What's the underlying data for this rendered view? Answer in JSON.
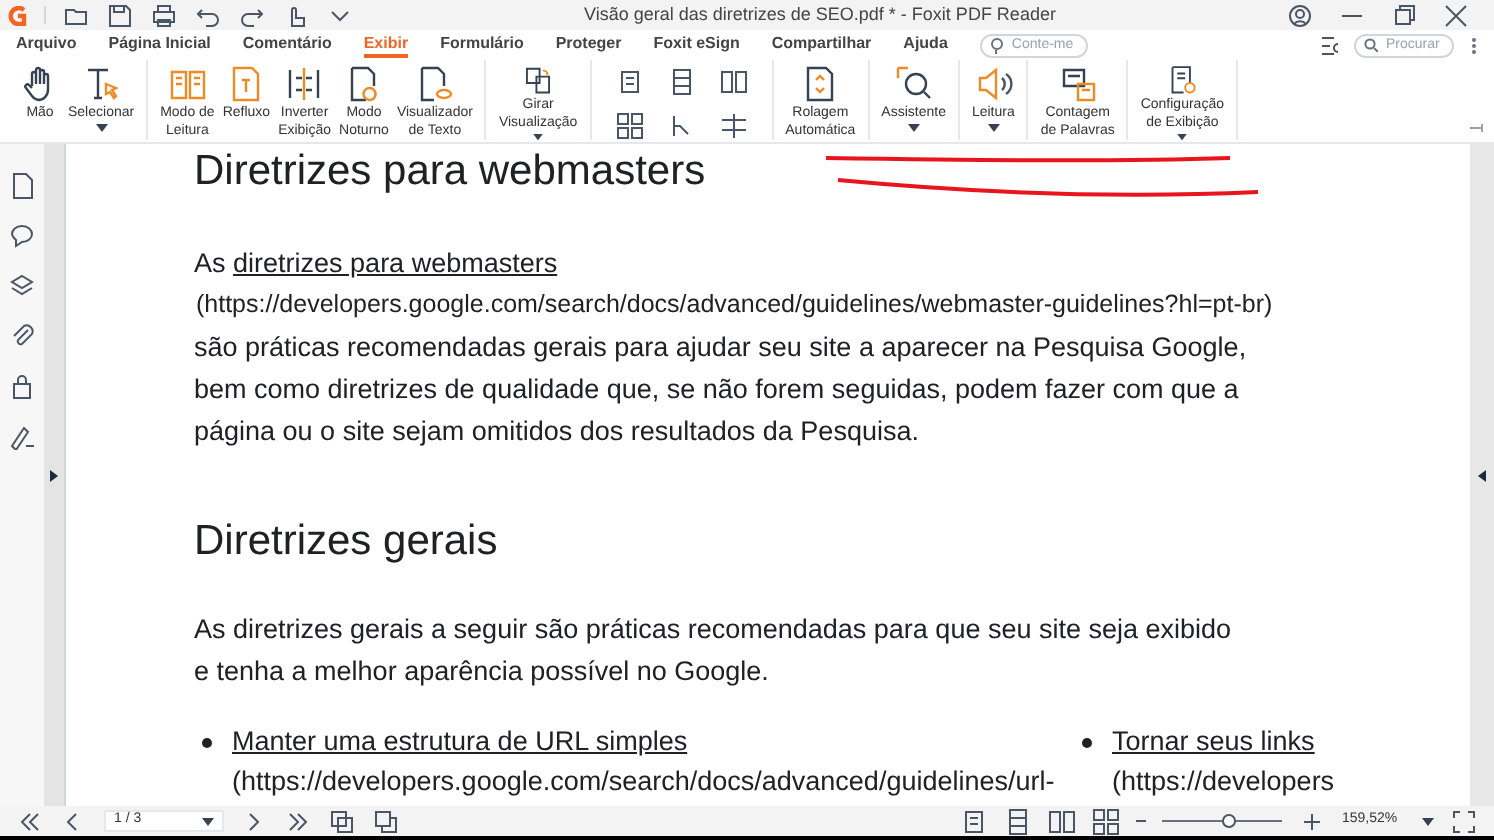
{
  "window": {
    "title": "Visão geral das diretrizes de SEO.pdf * - Foxit PDF Reader"
  },
  "menu_tabs": [
    {
      "label": "Arquivo",
      "selected": false
    },
    {
      "label": "Página Inicial",
      "selected": false
    },
    {
      "label": "Comentário",
      "selected": false
    },
    {
      "label": "Exibir",
      "selected": true
    },
    {
      "label": "Formulário",
      "selected": false
    },
    {
      "label": "Proteger",
      "selected": false
    },
    {
      "label": "Foxit eSign",
      "selected": false
    },
    {
      "label": "Compartilhar",
      "selected": false
    },
    {
      "label": "Ajuda",
      "selected": false
    }
  ],
  "tell_me": {
    "placeholder": "Conte-me"
  },
  "search": {
    "placeholder": "Procurar"
  },
  "ribbon": [
    {
      "kind": "group",
      "items": [
        {
          "label": "Mão",
          "dropdown": false
        },
        {
          "label": "Selecionar",
          "dropdown": true
        }
      ]
    },
    {
      "kind": "group",
      "items": [
        {
          "label": "Modo de\nLeitura",
          "dropdown": false
        },
        {
          "label": "Refluxo",
          "dropdown": false
        },
        {
          "label": "Inverter\nExibição",
          "dropdown": false
        },
        {
          "label": "Modo\nNoturno",
          "dropdown": false
        },
        {
          "label": "Visualizador\nde Texto",
          "dropdown": false
        }
      ]
    },
    {
      "kind": "group",
      "items": [
        {
          "label": "Girar\nVisualização",
          "dropdown": true
        }
      ]
    },
    {
      "kind": "layout"
    },
    {
      "kind": "group",
      "items": [
        {
          "label": "Rolagem\nAutomática",
          "dropdown": false
        }
      ]
    },
    {
      "kind": "group",
      "items": [
        {
          "label": "Assistente",
          "dropdown": true
        }
      ]
    },
    {
      "kind": "group",
      "items": [
        {
          "label": "Leitura",
          "dropdown": true
        }
      ]
    },
    {
      "kind": "group",
      "items": [
        {
          "label": "Contagem\nde Palavras",
          "dropdown": false
        }
      ]
    },
    {
      "kind": "group",
      "items": [
        {
          "label": "Configuração\nde Exibição",
          "dropdown": true
        }
      ]
    }
  ],
  "document": [
    {
      "kind": "heading",
      "text": "Diretrizes para webmasters"
    },
    {
      "kind": "paragraph",
      "link": "diretrizes para webmasters",
      "prefix": "As",
      "url": "(https://developers.google.com/search/docs/advanced/guidelines/webmaster-guidelines?hl=pt-br)",
      "text": "são práticas recomendadas gerais para ajudar seu site a aparecer na Pesquisa Google, bem como diretrizes de qualidade que, se não forem seguidas, podem fazer com que a página ou o site sejam omitidos dos resultados da Pesquisa."
    },
    {
      "kind": "heading",
      "text": "Diretrizes gerais"
    },
    {
      "kind": "plain",
      "text": "As diretrizes gerais a seguir são práticas recomendadas para que seu site seja exibido e tenha a melhor aparência possível no Google."
    },
    {
      "kind": "bullets",
      "items": [
        {
          "link": "Manter uma estrutura de URL simples",
          "url": "(https://developers.google.com/search/docs/advanced/guidelines/url-"
        },
        {
          "link": "Tornar seus links",
          "url": "(https://developers"
        }
      ]
    }
  ],
  "status_bar": {
    "page": "1 / 3",
    "zoom": "159,52%",
    "zoom_slider": {
      "level": 0.55
    }
  }
}
